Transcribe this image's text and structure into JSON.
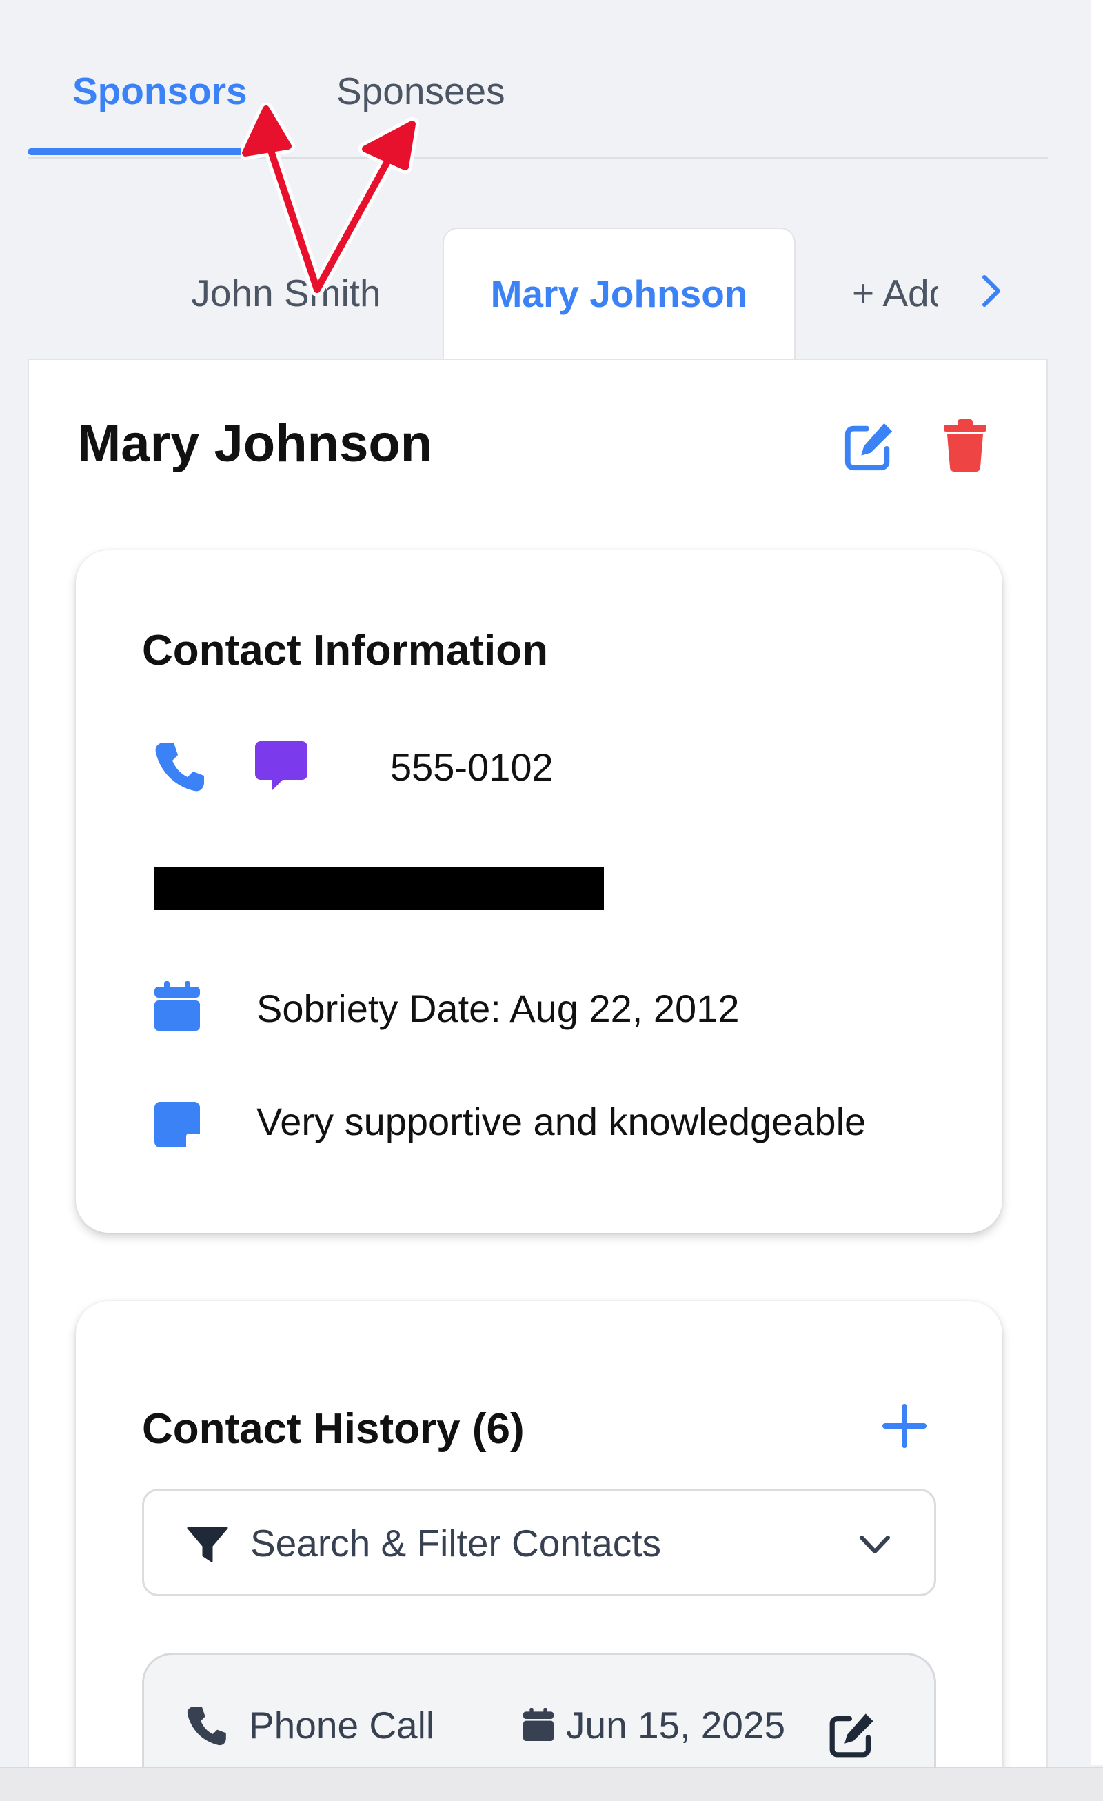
{
  "top_tabs": {
    "sponsors": "Sponsors",
    "sponsees": "Sponsees"
  },
  "person_tabs": {
    "john": "John Smith",
    "mary": "Mary Johnson",
    "add": "+ Add"
  },
  "profile": {
    "name": "Mary Johnson"
  },
  "contact_info": {
    "title": "Contact Information",
    "phone": "555-0102",
    "sobriety": "Sobriety Date: Aug 22, 2012",
    "notes": "Very supportive and knowledgeable"
  },
  "contact_history": {
    "title": "Contact History (6)",
    "filter_label": "Search & Filter Contacts",
    "items": [
      {
        "type": "Phone Call",
        "date": "Jun 15, 2025"
      }
    ]
  },
  "colors": {
    "accent": "#3b82f6",
    "danger": "#ef4444",
    "message": "#7c3aed",
    "annotation": "#e8112d"
  },
  "icons": [
    "chevron-right-icon",
    "edit-icon",
    "trash-icon",
    "phone-icon",
    "message-icon",
    "calendar-icon",
    "note-icon",
    "plus-icon",
    "filter-icon",
    "chevron-down-icon"
  ]
}
